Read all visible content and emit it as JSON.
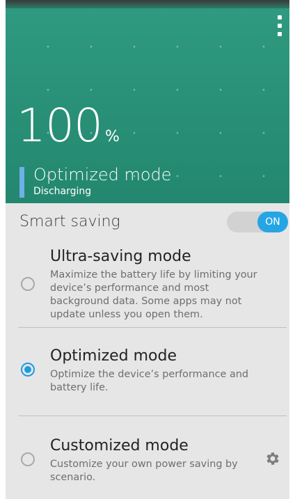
{
  "battery": {
    "percent": "100",
    "percent_sign": "%",
    "mode_name": "Optimized mode",
    "status": "Discharging"
  },
  "smart_saving": {
    "label": "Smart saving",
    "toggle_label": "ON"
  },
  "options": [
    {
      "title": "Ultra-saving mode",
      "description": "Maximize the battery life by limiting your device’s performance and most background data. Some apps may not update unless you open them.",
      "selected": false
    },
    {
      "title": "Optimized mode",
      "description": "Optimize the device’s performance and battery life.",
      "selected": true
    },
    {
      "title": "Customized mode",
      "description": "Customize your own power saving by scenario.",
      "selected": false
    }
  ],
  "icons": {
    "menu": "more-vert-icon",
    "settings": "gear-icon"
  },
  "colors": {
    "header": "#2a9078",
    "accent": "#26a5e4",
    "mode_bar": "#6fb0e6",
    "panel": "#e6e6e6"
  }
}
